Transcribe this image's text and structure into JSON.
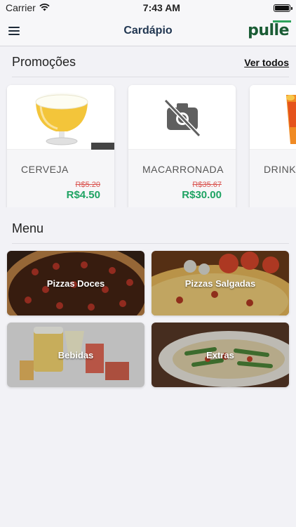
{
  "status_bar": {
    "carrier": "Carrier",
    "time": "7:43 AM"
  },
  "nav": {
    "title": "Cardápio",
    "logo": "pulle"
  },
  "promotions": {
    "title": "Promoções",
    "see_all": "Ver todos",
    "items": [
      {
        "name": "CERVEJA",
        "old_price": "R$5.20",
        "new_price": "R$4.50"
      },
      {
        "name": "MACARRONADA",
        "old_price": "R$35.67",
        "new_price": "R$30.00"
      },
      {
        "name": "DRINK",
        "old_price": "",
        "new_price": ""
      }
    ]
  },
  "menu": {
    "title": "Menu",
    "items": [
      {
        "label": "Pizzas Doces"
      },
      {
        "label": "Pizzas Salgadas"
      },
      {
        "label": "Bebidas"
      },
      {
        "label": "Extras"
      }
    ]
  },
  "colors": {
    "accent": "#1fa363",
    "old_price": "#d9534f",
    "nav_title": "#1f3550",
    "logo": "#1a5c35"
  }
}
